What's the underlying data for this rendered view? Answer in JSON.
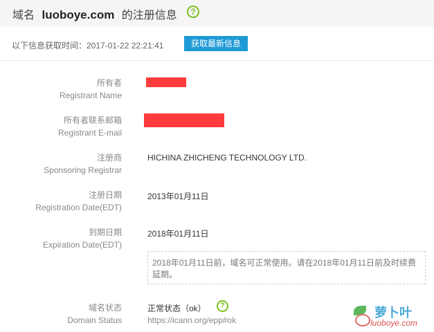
{
  "header": {
    "title_prefix": "域名",
    "domain": "luoboye.com",
    "title_suffix": "的注册信息",
    "help_icon": "question-circle-icon"
  },
  "subbar": {
    "query_time": "以下信息获取时间：2017-01-22 22:21:41",
    "refresh_button": "获取最新信息"
  },
  "fields": {
    "registrant_name": {
      "label_cn": "所有者",
      "label_en": "Registrant Name"
    },
    "registrant_email": {
      "label_cn": "所有者联系邮箱",
      "label_en": "Registrant E-mail"
    },
    "registrar": {
      "label_cn": "注册商",
      "label_en": "Sponsoring Registrar",
      "value": "HICHINA ZHICHENG TECHNOLOGY LTD."
    },
    "registration_date": {
      "label_cn": "注册日期",
      "label_en": "Registration Date(EDT)",
      "value": "2013年01月11日"
    },
    "expiration_date": {
      "label_cn": "到期日期",
      "label_en": "Expiration Date(EDT)",
      "value": "2018年01月11日",
      "notice": "2018年01月11日前，域名可正常使用。请在2018年01月11日前及时续费延期。"
    },
    "domain_status": {
      "label_cn": "域名状态",
      "label_en": "Domain Status",
      "value": "正常状态（ok）",
      "link": "https://icann.org/epp#ok",
      "help_icon": "question-circle-icon"
    }
  },
  "watermark": {
    "name_cn": "萝卜叶",
    "name_en": "luoboye.com",
    "icon": "radish-logo"
  },
  "colors": {
    "accent": "#1e9ad6",
    "help_green": "#7fbf1e",
    "redaction": "#ff3b3b"
  }
}
